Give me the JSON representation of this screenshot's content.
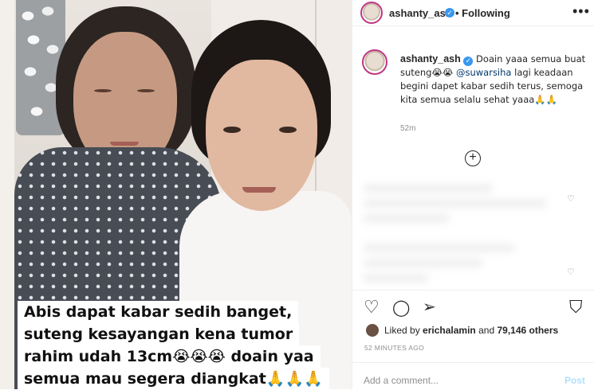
{
  "photo": {
    "caption_lines": [
      "Abis dapat kabar sedih banget,",
      "suteng kesayangan kena tumor",
      "rahim udah 13cm😭😭😭 doain yaa",
      "semua mau segera diangkat🙏🙏🙏"
    ]
  },
  "header": {
    "username": "ashanty_ash",
    "verified_glyph": "✓",
    "following_label": "• Following",
    "more_label": "•••"
  },
  "post": {
    "username": "ashanty_ash",
    "caption_part1": "Doain yaaa semua buat suteng😭😭",
    "mention": "@suwarsiha",
    "caption_part2": "lagi keadaan begini dapet kabar sedih terus, semoga kita semua selalu sehat yaaa🙏🙏",
    "time": "52m",
    "load_more_icon": "plus-circle-icon"
  },
  "actions": {
    "like_icon": "♡",
    "comment_icon": "◯",
    "share_icon": "➢",
    "save_icon": "⛉"
  },
  "likes": {
    "prefix": "Liked by",
    "user": "erichalamin",
    "middle": "and",
    "count": "79,146 others"
  },
  "timestamp": "52 MINUTES AGO",
  "comment": {
    "placeholder": "Add a comment...",
    "post_label": "Post"
  },
  "colors": {
    "accent": "#3897f0",
    "mention": "#00376b",
    "muted": "#8e8e8e",
    "post_disabled": "#b2dffc"
  }
}
